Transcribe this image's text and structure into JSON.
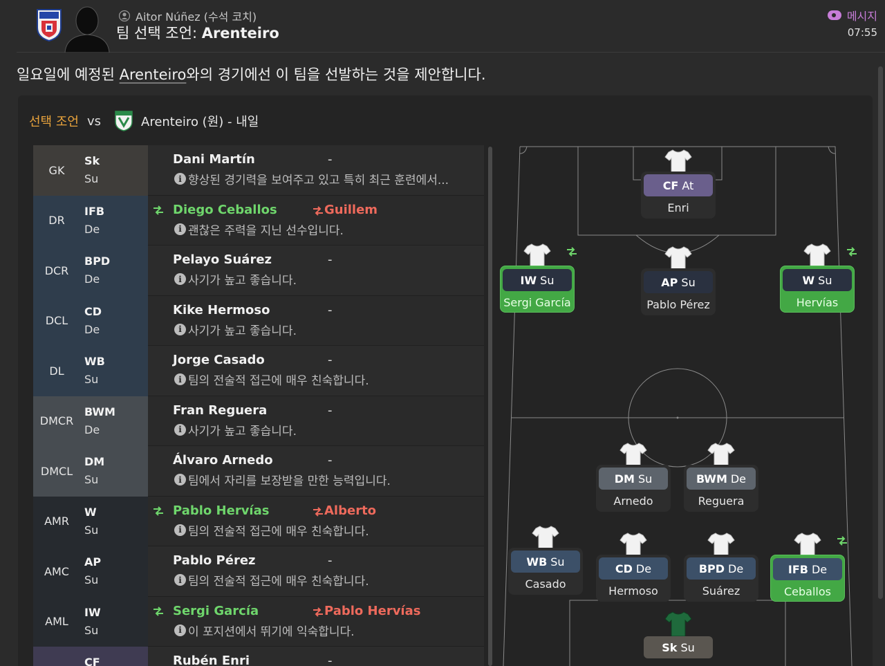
{
  "header": {
    "coach": "Aitor Núñez (수석 코치)",
    "title_prefix": "팀 선택 조언: ",
    "title_team": "Arenteiro",
    "messages_label": "메시지",
    "time": "07:55"
  },
  "intro": {
    "part1": "일요일에 예정된 ",
    "team_link": "Arenteiro",
    "part2": "와의 경기에선 이 팀을 선발하는 것을 제안합니다."
  },
  "match": {
    "selection_label": "선택 조언",
    "vs_label": "vs",
    "opponent_text": "Arenteiro (원) - 내일"
  },
  "colors": {
    "accent_orange": "#e9a33c",
    "swap_in_green": "#6fd66c",
    "swap_out_red": "#ee6a5c",
    "selected_card": "#43a845"
  },
  "rows": [
    {
      "pos": "GK",
      "role": "Sk",
      "duty": "Su",
      "player": "Dani Martín",
      "replaced": "-",
      "comment": "향상된 경기력을 보여주고 있고 특히 최근 훈련에서...",
      "changed": false,
      "band": "#3f3d3a"
    },
    {
      "pos": "DR",
      "role": "IFB",
      "duty": "De",
      "player": "Diego Ceballos",
      "replaced": "Guillem",
      "comment": "괜찮은 주력을 지닌 선수입니다.",
      "changed": true,
      "band": "#2f3d4c"
    },
    {
      "pos": "DCR",
      "role": "BPD",
      "duty": "De",
      "player": "Pelayo Suárez",
      "replaced": "-",
      "comment": "사기가 높고 좋습니다.",
      "changed": false,
      "band": "#2f3d4c"
    },
    {
      "pos": "DCL",
      "role": "CD",
      "duty": "De",
      "player": "Kike Hermoso",
      "replaced": "-",
      "comment": "사기가 높고 좋습니다.",
      "changed": false,
      "band": "#2f3d4c"
    },
    {
      "pos": "DL",
      "role": "WB",
      "duty": "Su",
      "player": "Jorge Casado",
      "replaced": "-",
      "comment": "팀의 전술적 접근에 매우 친숙합니다.",
      "changed": false,
      "band": "#2f3d4c"
    },
    {
      "pos": "DMCR",
      "role": "BWM",
      "duty": "De",
      "player": "Fran Reguera",
      "replaced": "-",
      "comment": "사기가 높고 좋습니다.",
      "changed": false,
      "band": "#474c51"
    },
    {
      "pos": "DMCL",
      "role": "DM",
      "duty": "Su",
      "player": "Álvaro Arnedo",
      "replaced": "-",
      "comment": "팀에서 자리를 보장받을 만한 능력입니다.",
      "changed": false,
      "band": "#474c51"
    },
    {
      "pos": "AMR",
      "role": "W",
      "duty": "Su",
      "player": "Pablo Hervías",
      "replaced": "Alberto",
      "comment": "팀의 전술적 접근에 매우 친숙합니다.",
      "changed": true,
      "band": "#262a2f"
    },
    {
      "pos": "AMC",
      "role": "AP",
      "duty": "Su",
      "player": "Pablo Pérez",
      "replaced": "-",
      "comment": "팀의 전술적 접근에 매우 친숙합니다.",
      "changed": false,
      "band": "#262a2f"
    },
    {
      "pos": "AML",
      "role": "IW",
      "duty": "Su",
      "player": "Sergi García",
      "replaced": "Pablo Hervías",
      "comment": "이 포지션에서 뛰기에 익숙합니다.",
      "changed": true,
      "band": "#262a2f"
    },
    {
      "pos": "",
      "role": "CF",
      "duty": "",
      "player": "Rubén Enri",
      "replaced": "-",
      "comment": "",
      "changed": false,
      "band": "#3f3b52"
    }
  ],
  "pitch": {
    "players": [
      {
        "id": "cf",
        "role": "CF",
        "duty": "At",
        "name": "Enri",
        "tag_color": "#6a5f8c",
        "selected": false,
        "swapped": false
      },
      {
        "id": "iw",
        "role": "IW",
        "duty": "Su",
        "name": "Sergi García",
        "tag_color": "#2a3140",
        "selected": true,
        "swapped": true
      },
      {
        "id": "ap",
        "role": "AP",
        "duty": "Su",
        "name": "Pablo Pérez",
        "tag_color": "#2a3140",
        "selected": false,
        "swapped": false
      },
      {
        "id": "w",
        "role": "W",
        "duty": "Su",
        "name": "Hervías",
        "tag_color": "#2a3140",
        "selected": true,
        "swapped": true
      },
      {
        "id": "dm",
        "role": "DM",
        "duty": "Su",
        "name": "Arnedo",
        "tag_color": "#5d646c",
        "selected": false,
        "swapped": false
      },
      {
        "id": "bwm",
        "role": "BWM",
        "duty": "De",
        "name": "Reguera",
        "tag_color": "#5d646c",
        "selected": false,
        "swapped": false
      },
      {
        "id": "wb",
        "role": "WB",
        "duty": "Su",
        "name": "Casado",
        "tag_color": "#3c5068",
        "selected": false,
        "swapped": false
      },
      {
        "id": "cd",
        "role": "CD",
        "duty": "De",
        "name": "Hermoso",
        "tag_color": "#3c5068",
        "selected": false,
        "swapped": false
      },
      {
        "id": "bpd",
        "role": "BPD",
        "duty": "De",
        "name": "Suárez",
        "tag_color": "#3c5068",
        "selected": false,
        "swapped": false
      },
      {
        "id": "ifb",
        "role": "IFB",
        "duty": "De",
        "name": "Ceballos",
        "tag_color": "#3c5068",
        "selected": true,
        "swapped": true
      },
      {
        "id": "gk",
        "role": "Sk",
        "duty": "Su",
        "name": "",
        "tag_color": "#5a5650",
        "selected": false,
        "swapped": false
      }
    ]
  }
}
